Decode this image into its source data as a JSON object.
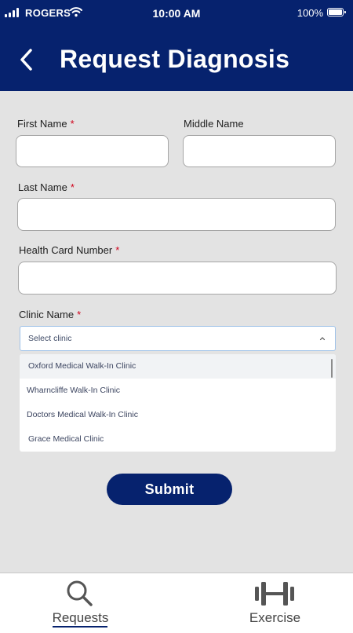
{
  "status_bar": {
    "carrier": "ROGERS",
    "time": "10:00 AM",
    "battery": "100%"
  },
  "header": {
    "title": "Request Diagnosis",
    "back_icon": "chevron-left-icon"
  },
  "form": {
    "first_name_label": "First Name",
    "middle_name_label": "Middle Name",
    "last_name_label": "Last Name",
    "health_card_label": "Health Card Number",
    "clinic_label": "Clinic Name",
    "required_marker": "*",
    "clinic_select": {
      "placeholder": "Select clinic",
      "options": [
        "Oxford Medical Walk-In Clinic",
        "Wharncliffe Walk-In Clinic",
        "Doctors Medical Walk-In Clinic",
        "Grace Medical Clinic"
      ]
    },
    "submit_label": "Submit"
  },
  "tabbar": {
    "tabs": [
      {
        "label": "Requests",
        "icon": "search-icon",
        "active": true
      },
      {
        "label": "Exercise",
        "icon": "dumbbell-icon",
        "active": false
      }
    ]
  },
  "colors": {
    "primary": "#06226e",
    "required": "#d0021b",
    "background": "#e3e3e3"
  }
}
